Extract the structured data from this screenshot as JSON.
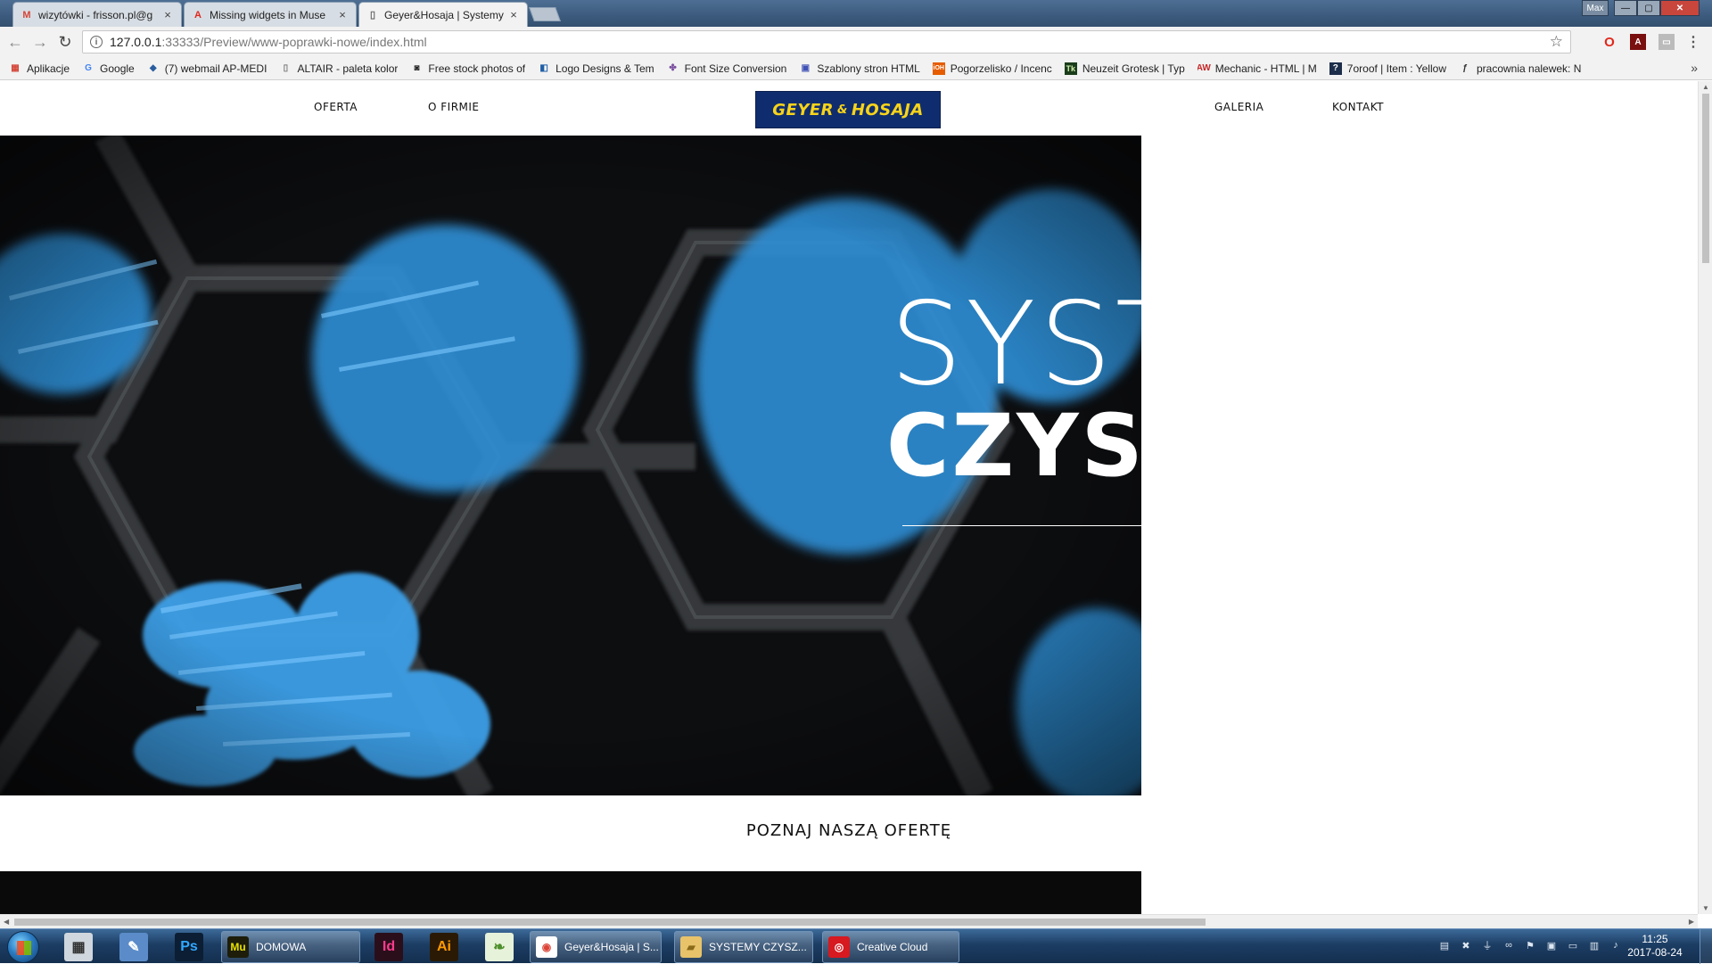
{
  "browser": {
    "tabs": [
      {
        "title": "wizytówki - frisson.pl@g",
        "icon": "gmail-icon",
        "active": false
      },
      {
        "title": "Missing widgets in Muse",
        "icon": "adobe-icon",
        "active": false
      },
      {
        "title": "Geyer&Hosaja | Systemy",
        "icon": "page-icon",
        "active": true
      }
    ],
    "window_user": "Max",
    "url_host": "127.0.0.1",
    "url_path": ":33333/Preview/www-poprawki-nowe/index.html",
    "bookmarks": [
      {
        "label": "Aplikacje",
        "icon": "apps-grid-icon",
        "color": "#d44638"
      },
      {
        "label": "Google",
        "icon": "google-icon",
        "color": "#4285f4"
      },
      {
        "label": "(7) webmail AP-MEDI",
        "icon": "webmail-icon",
        "color": "#2a5d9f"
      },
      {
        "label": "ALTAIR - paleta kolor",
        "icon": "page-icon",
        "color": "#777777"
      },
      {
        "label": "Free stock photos of",
        "icon": "camera-icon",
        "color": "#222222"
      },
      {
        "label": "Logo Designs & Tem",
        "icon": "logo-icon",
        "color": "#1f5fa8"
      },
      {
        "label": "Font Size Conversion",
        "icon": "pinwheel-icon",
        "color": "#7a4fa0"
      },
      {
        "label": "Szablony stron HTML",
        "icon": "template-icon",
        "color": "#3f51b5"
      },
      {
        "label": "Pogorzelisko / Incenc",
        "icon": "ioh-icon",
        "color": "#e65c00"
      },
      {
        "label": "Neuzeit Grotesk | Typ",
        "icon": "tk-icon",
        "color": "#1a3d1a"
      },
      {
        "label": "Mechanic - HTML | M",
        "icon": "aw-icon",
        "color": "#c62828"
      },
      {
        "label": "7oroof | Item : Yellow",
        "icon": "help-icon",
        "color": "#1c2e4a"
      },
      {
        "label": "pracownia nalewek: N",
        "icon": "bottle-icon",
        "color": "#333333"
      }
    ]
  },
  "site": {
    "nav": {
      "oferta": "OFERTA",
      "o_firmie": "O FIRMIE",
      "galeria": "GALERIA",
      "kontakt": "KONTAKT"
    },
    "logo": {
      "left": "GEYER",
      "amp": "&",
      "right": "HOSAJA"
    },
    "hero": {
      "line1": "SYST",
      "line2": "CZYSZ"
    },
    "offer_heading": "POZNAJ NASZĄ OFERTĘ"
  },
  "taskbar": {
    "pinned": [
      {
        "name": "calculator-icon",
        "glyph": "▦",
        "bg": "#cfd6dd",
        "fg": "#333333"
      },
      {
        "name": "paint-icon",
        "glyph": "✎",
        "bg": "#5b8cc9",
        "fg": "#ffffff"
      },
      {
        "name": "photoshop-icon",
        "glyph": "Ps",
        "bg": "#0b1e33",
        "fg": "#31a8ff"
      }
    ],
    "tasks": [
      {
        "label": "DOMOWA",
        "glyph": "Mu",
        "bg": "#1d1d0a",
        "fg": "#e8e200"
      },
      {
        "label": "Geyer&Hosaja | S...",
        "glyph": "◉",
        "bg": "#ffffff",
        "fg": "#db4437"
      },
      {
        "label": "SYSTEMY CZYSZ...",
        "glyph": "▰",
        "bg": "#e8c36a",
        "fg": "#8a6a1a"
      },
      {
        "label": "Creative Cloud",
        "glyph": "◎",
        "bg": "#d71920",
        "fg": "#ffffff"
      }
    ],
    "pinned2": [
      {
        "name": "indesign-icon",
        "glyph": "Id",
        "bg": "#2a0f1b",
        "fg": "#ff3b8d"
      },
      {
        "name": "illustrator-icon",
        "glyph": "Ai",
        "bg": "#2a1a05",
        "fg": "#ff9a00"
      },
      {
        "name": "app-leaf-icon",
        "glyph": "❧",
        "bg": "#e6f2d9",
        "fg": "#4d8f2c"
      }
    ],
    "clock_time": "11:25",
    "clock_date": "2017-08-24"
  },
  "colors": {
    "logo_bg": "#0f2d6e",
    "logo_text": "#f7d31a",
    "brush_blue": "#2f8fd6"
  }
}
